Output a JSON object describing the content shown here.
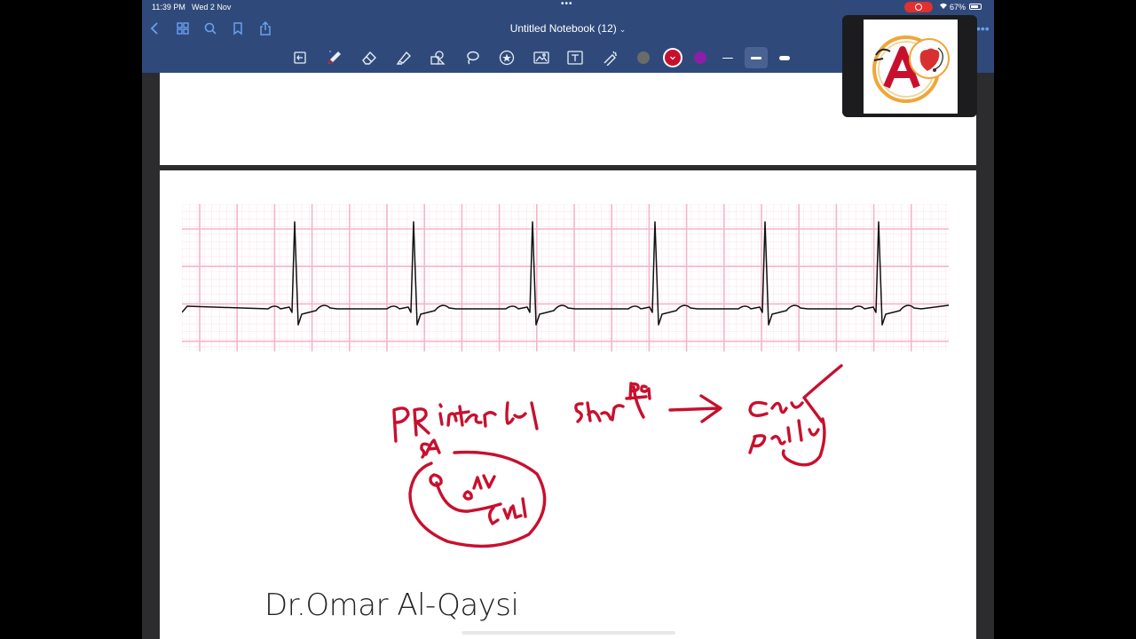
{
  "status_bar": {
    "time": "11:39 PM",
    "date": "Wed 2 Nov",
    "battery": "67%"
  },
  "nav_bar": {
    "title": "Untitled Notebook (12)",
    "icons": [
      "back-icon",
      "grid-icon",
      "search-icon",
      "bookmark-icon",
      "share-icon",
      "more-icon"
    ]
  },
  "toolbar": {
    "tools": [
      "read-only-toggle-icon",
      "pen-icon",
      "eraser-icon",
      "highlighter-icon",
      "shapes-icon",
      "lasso-icon",
      "sticker-icon",
      "image-icon",
      "text-icon",
      "laser-pointer-icon"
    ],
    "colors": [
      "#6b6b6b",
      "#c8102e",
      "#8a1fa8"
    ],
    "selected_color": "#c8102e",
    "stroke_widths": [
      "thin",
      "medium",
      "thick"
    ],
    "selected_stroke": "medium"
  },
  "page": {
    "watermark": "Dr.Omar Al-Qaysi"
  },
  "colors": {
    "ink": "#c8102e",
    "ecg_grid": "#f2b6c8",
    "ecg_line": "#111111",
    "chrome": "#2f4a7a",
    "accent": "#6aa0f0"
  }
}
